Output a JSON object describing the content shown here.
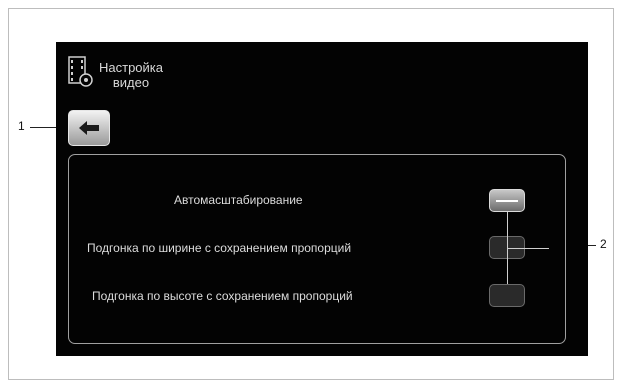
{
  "header": {
    "icon": "video-settings-icon",
    "title_line1": "Настройка",
    "title_line2": "видео"
  },
  "back_button": {
    "icon": "arrow-left-icon"
  },
  "options": [
    {
      "label": "Автомасштабирование",
      "selected": true
    },
    {
      "label": "Подгонка по ширине с сохранением пропорций",
      "selected": false
    },
    {
      "label": "Подгонка по высоте с сохранением пропорций",
      "selected": false
    }
  ],
  "callouts": {
    "back": "1",
    "toggles": "2"
  }
}
